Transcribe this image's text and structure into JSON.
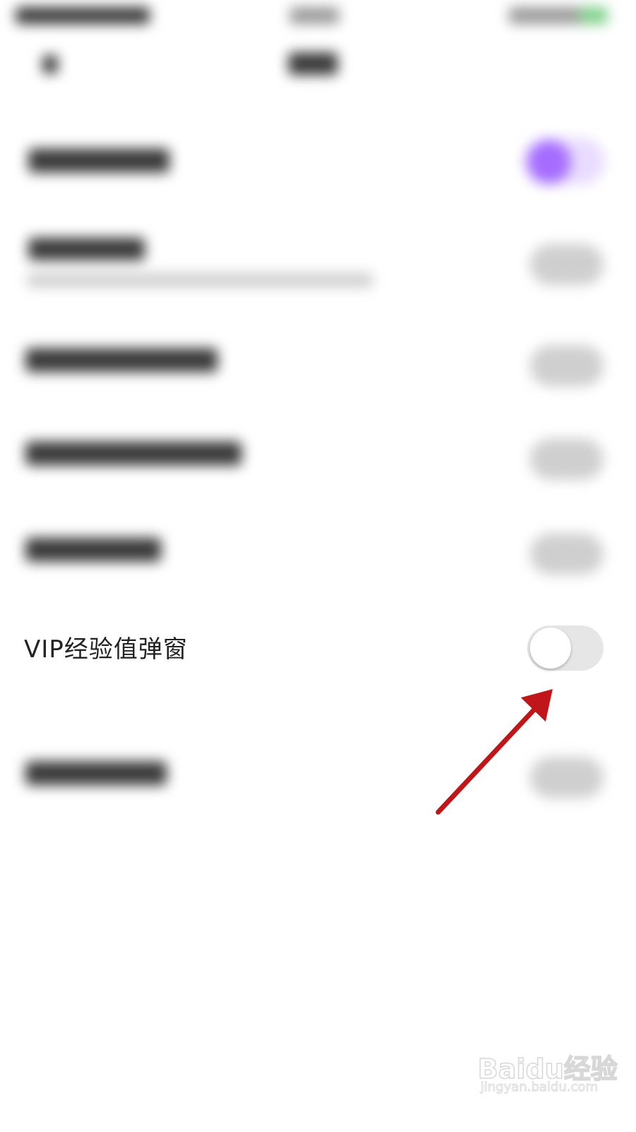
{
  "setting": {
    "label": "VIP经验值弹窗",
    "toggle_on": false
  },
  "watermark": {
    "brand": "Baidu经验",
    "url": "jingyan.baidu.com"
  },
  "colors": {
    "background": "#ffffff",
    "label_text": "#222222",
    "toggle_track_off": "#e6e6e6",
    "toggle_knob": "#ffffff",
    "blurred_toggle_on": "#a56cff",
    "arrow": "#c0161a"
  },
  "icons": {
    "annotation": "red-arrow-icon"
  }
}
